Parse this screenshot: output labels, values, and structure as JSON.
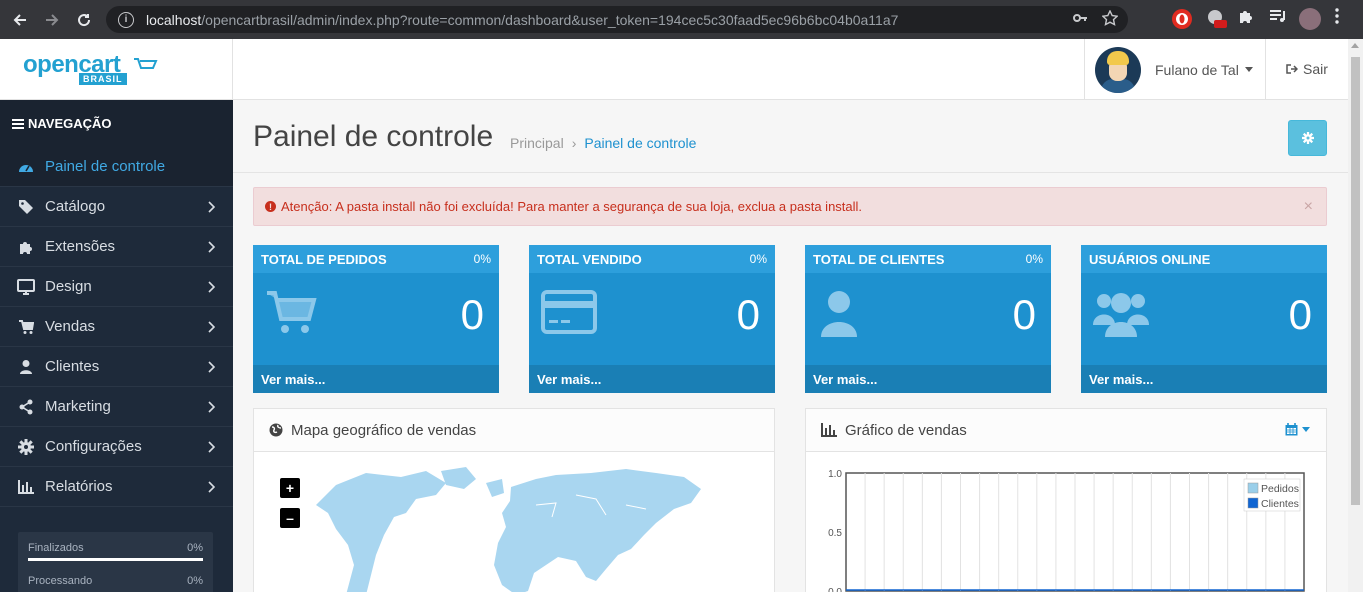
{
  "browser": {
    "url_host": "localhost",
    "url_path": "/opencartbrasil/admin/index.php?route=common/dashboard&user_token=194cec5c30faad5ec96b6bc04b0a11a7"
  },
  "header": {
    "logo_text": "opencart",
    "logo_sub": "BRASIL",
    "user_name": "Fulano de Tal",
    "logout_label": "Sair"
  },
  "sidebar": {
    "title": "NAVEGAÇÃO",
    "items": [
      {
        "label": "Painel de controle",
        "icon": "dashboard-icon"
      },
      {
        "label": "Catálogo",
        "icon": "tags-icon"
      },
      {
        "label": "Extensões",
        "icon": "puzzle-icon"
      },
      {
        "label": "Design",
        "icon": "monitor-icon"
      },
      {
        "label": "Vendas",
        "icon": "cart-icon"
      },
      {
        "label": "Clientes",
        "icon": "user-icon"
      },
      {
        "label": "Marketing",
        "icon": "share-icon"
      },
      {
        "label": "Configurações",
        "icon": "gear-icon"
      },
      {
        "label": "Relatórios",
        "icon": "bar-chart-icon"
      }
    ],
    "stats": [
      {
        "label": "Finalizados",
        "value": "0%"
      },
      {
        "label": "Processando",
        "value": "0%"
      }
    ]
  },
  "page": {
    "title": "Painel de controle",
    "breadcrumb": [
      "Principal",
      "Painel de controle"
    ]
  },
  "alert": {
    "text": "Atenção: A pasta install não foi excluída! Para manter a segurança de sua loja, exclua a pasta install.",
    "close": "×"
  },
  "tiles": [
    {
      "title": "TOTAL DE PEDIDOS",
      "pct": "0%",
      "value": "0",
      "link": "Ver mais...",
      "icon": "cart-icon"
    },
    {
      "title": "TOTAL VENDIDO",
      "pct": "0%",
      "value": "0",
      "link": "Ver mais...",
      "icon": "credit-card-icon"
    },
    {
      "title": "TOTAL DE CLIENTES",
      "pct": "0%",
      "value": "0",
      "link": "Ver mais...",
      "icon": "user-icon"
    },
    {
      "title": "USUÁRIOS ONLINE",
      "pct": "",
      "value": "0",
      "link": "Ver mais...",
      "icon": "users-icon"
    }
  ],
  "map_panel": {
    "title": "Mapa geográfico de vendas",
    "zoom_in": "+",
    "zoom_out": "–"
  },
  "chart_panel": {
    "title": "Gráfico de vendas"
  },
  "chart_data": {
    "type": "line",
    "title": "",
    "xlabel": "",
    "ylabel": "",
    "ylim": [
      0,
      1.0
    ],
    "y_ticks": [
      "1.0",
      "0.5",
      "0.0"
    ],
    "legend": "top-right",
    "grid": true,
    "series": [
      {
        "name": "Pedidos",
        "color": "#9acfea",
        "values": []
      },
      {
        "name": "Clientes",
        "color": "#1065d2",
        "values": []
      }
    ]
  },
  "colors": {
    "accent": "#1e91cf",
    "sidebar_bg": "#1e2a3a",
    "alert_text": "#c72f1d"
  }
}
